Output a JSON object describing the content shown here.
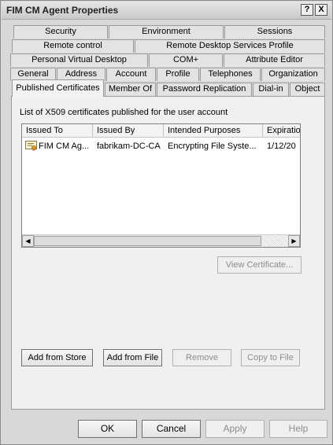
{
  "window": {
    "title": "FIM CM Agent Properties",
    "help_label": "?",
    "close_label": "X"
  },
  "tabs_row1": [
    "Security",
    "Environment",
    "Sessions"
  ],
  "tabs_row2": [
    "Remote control",
    "Remote Desktop Services Profile"
  ],
  "tabs_row3": [
    "Personal Virtual Desktop",
    "COM+",
    "Attribute Editor"
  ],
  "tabs_row4": [
    "General",
    "Address",
    "Account",
    "Profile",
    "Telephones",
    "Organization"
  ],
  "tabs_row5": [
    "Published Certificates",
    "Member Of",
    "Password Replication",
    "Dial-in",
    "Object"
  ],
  "panel": {
    "label": "List of X509 certificates published for the user account",
    "columns": [
      "Issued To",
      "Issued By",
      "Intended Purposes",
      "Expiration"
    ],
    "rows": [
      [
        "FIM CM Ag...",
        "fabrikam-DC-CA",
        "Encrypting File Syste...",
        "1/12/20"
      ]
    ],
    "view_certificate": "View Certificate...",
    "add_from_store": "Add from Store",
    "add_from_file": "Add from File",
    "remove": "Remove",
    "copy_to_file": "Copy to File"
  },
  "footer": {
    "ok": "OK",
    "cancel": "Cancel",
    "apply": "Apply",
    "help": "Help"
  },
  "icons": {
    "certificate": "certificate-icon",
    "scroll_left": "scroll-left-arrow-icon",
    "scroll_right": "scroll-right-arrow-icon"
  }
}
